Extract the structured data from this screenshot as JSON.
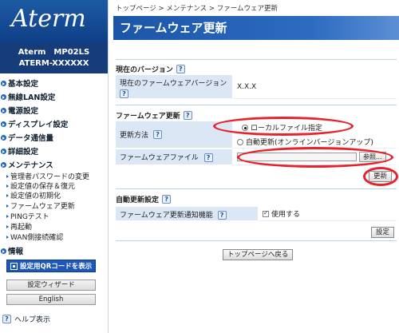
{
  "sidebar": {
    "logo": "Aterm",
    "model_line1": "Aterm　MP02LS",
    "model_line2": "ATERM-XXXXXX",
    "menu": [
      {
        "label": "基本設定"
      },
      {
        "label": "無線LAN設定"
      },
      {
        "label": "電源設定"
      },
      {
        "label": "ディスプレイ設定"
      },
      {
        "label": "データ通信量"
      },
      {
        "label": "詳細設定"
      },
      {
        "label": "メンテナンス"
      }
    ],
    "maintenance_items": [
      "管理者パスワードの変更",
      "設定値の保存＆復元",
      "設定値の初期化",
      "ファームウェア更新",
      "PINGテスト",
      "再起動",
      "WAN側接続確認"
    ],
    "info_label": "情報",
    "qr_button": "設定用QRコードを表示",
    "wizard_button": "設定ウィザード",
    "english_button": "English",
    "help_label": "ヘルプ表示",
    "help_glyph": "?"
  },
  "main": {
    "breadcrumb": "トップページ > メンテナンス > ファームウェア更新",
    "title": "ファームウェア更新",
    "current_version": {
      "heading": "現在のバージョン",
      "label": "現在のファームウェアバージョン",
      "value": "X.X.X"
    },
    "update": {
      "heading": "ファームウェア更新",
      "method_label": "更新方法",
      "option_local": "ローカルファイル指定",
      "option_auto": "自動更新(オンラインバージョンアップ)",
      "selected": "local",
      "file_label": "ファームウェアファイル",
      "browse_button": "参照...",
      "update_button": "更新"
    },
    "auto_update": {
      "heading": "自動更新設定",
      "notify_label": "ファームウェア更新通知機能",
      "checkbox_label": "使用する",
      "checked": true,
      "set_button": "設定"
    },
    "back_button": "トップページへ戻る"
  },
  "colors": {
    "title_bar": "#1b55a7",
    "label_bg": "#dbe7f5",
    "highlight": "#e8212a"
  }
}
